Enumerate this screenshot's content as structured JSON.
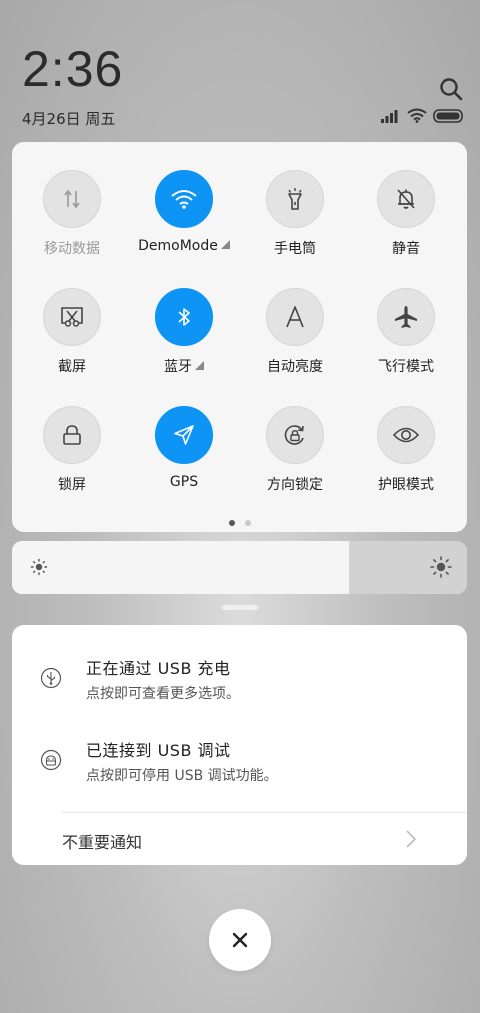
{
  "status": {
    "time": "2:36",
    "date": "4月26日 周五"
  },
  "quick_settings": {
    "tiles": [
      {
        "label": "移动数据",
        "active": false,
        "disabled": true,
        "icon": "mobile-data-icon"
      },
      {
        "label": "DemoMode",
        "active": true,
        "disabled": false,
        "icon": "wifi-icon",
        "expandable": true
      },
      {
        "label": "手电筒",
        "active": false,
        "disabled": false,
        "icon": "flashlight-icon"
      },
      {
        "label": "静音",
        "active": false,
        "disabled": false,
        "icon": "bell-off-icon"
      },
      {
        "label": "截屏",
        "active": false,
        "disabled": false,
        "icon": "screenshot-icon"
      },
      {
        "label": "蓝牙",
        "active": true,
        "disabled": false,
        "icon": "bluetooth-icon",
        "expandable": true
      },
      {
        "label": "自动亮度",
        "active": false,
        "disabled": false,
        "icon": "auto-brightness-icon"
      },
      {
        "label": "飞行模式",
        "active": false,
        "disabled": false,
        "icon": "airplane-icon"
      },
      {
        "label": "锁屏",
        "active": false,
        "disabled": false,
        "icon": "lock-icon"
      },
      {
        "label": "GPS",
        "active": true,
        "disabled": false,
        "icon": "location-arrow-icon"
      },
      {
        "label": "方向锁定",
        "active": false,
        "disabled": false,
        "icon": "rotation-lock-icon"
      },
      {
        "label": "护眼模式",
        "active": false,
        "disabled": false,
        "icon": "eye-icon"
      }
    ],
    "page_count": 2,
    "current_page": 1
  },
  "brightness": {
    "level_fraction": 0.74
  },
  "notifications": {
    "items": [
      {
        "title": "正在通过 USB 充电",
        "subtitle": "点按即可查看更多选项。",
        "icon": "usb-icon"
      },
      {
        "title": "已连接到 USB 调试",
        "subtitle": "点按即可停用 USB 调试功能。",
        "icon": "android-debug-icon"
      }
    ],
    "footer_label": "不重要通知"
  },
  "colors": {
    "accent": "#0d94f5",
    "tile_inactive": "#e3e3e3",
    "panel_bg": "#f6f6f6"
  }
}
